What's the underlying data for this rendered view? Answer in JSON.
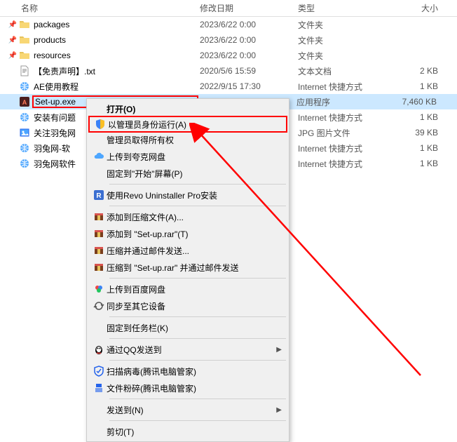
{
  "columns": {
    "name": "名称",
    "date": "修改日期",
    "type": "类型",
    "size": "大小"
  },
  "files": [
    {
      "name": "packages",
      "date": "2023/6/22 0:00",
      "type": "文件夹",
      "size": "",
      "icon": "folder",
      "pinned": true
    },
    {
      "name": "products",
      "date": "2023/6/22 0:00",
      "type": "文件夹",
      "size": "",
      "icon": "folder",
      "pinned": true
    },
    {
      "name": "resources",
      "date": "2023/6/22 0:00",
      "type": "文件夹",
      "size": "",
      "icon": "folder",
      "pinned": true
    },
    {
      "name": "【免责声明】.txt",
      "date": "2020/5/6 15:59",
      "type": "文本文档",
      "size": "2 KB",
      "icon": "txt",
      "pinned": false
    },
    {
      "name": "AE使用教程",
      "date": "2022/9/15 17:30",
      "type": "Internet 快捷方式",
      "size": "1 KB",
      "icon": "url",
      "pinned": false
    },
    {
      "name": "Set-up.exe",
      "date": "",
      "type": "应用程序",
      "size": "7,460 KB",
      "icon": "exe",
      "pinned": false,
      "selected": true,
      "highlight": true
    },
    {
      "name": "安装有问题",
      "date": "",
      "type": "Internet 快捷方式",
      "size": "1 KB",
      "icon": "url",
      "pinned": false
    },
    {
      "name": "关注羽兔网",
      "date": "",
      "type": "JPG 图片文件",
      "size": "39 KB",
      "icon": "jpg",
      "pinned": false
    },
    {
      "name": "羽兔网-软",
      "date": "",
      "type": "Internet 快捷方式",
      "size": "1 KB",
      "icon": "url",
      "pinned": false
    },
    {
      "name": "羽兔网软件",
      "date": "",
      "type": "Internet 快捷方式",
      "size": "1 KB",
      "icon": "url",
      "pinned": false
    }
  ],
  "menu": {
    "open": "打开(O)",
    "runas": "以管理员身份运行(A)",
    "takeown": "管理员取得所有权",
    "kuake": "上传到夸克网盘",
    "pintostart": "固定到\"开始\"屏幕(P)",
    "revo": "使用Revo Uninstaller Pro安装",
    "rar_add": "添加到压缩文件(A)...",
    "rar_addto": "添加到 \"Set-up.rar\"(T)",
    "rar_mail": "压缩并通过邮件发送...",
    "rar_mailto": "压缩到 \"Set-up.rar\" 并通过邮件发送",
    "baidu": "上传到百度网盘",
    "baidu_sync": "同步至其它设备",
    "pintaskbar": "固定到任务栏(K)",
    "qq": "通过QQ发送到",
    "scan": "扫描病毒(腾讯电脑管家)",
    "shred": "文件粉碎(腾讯电脑管家)",
    "sendto": "发送到(N)",
    "cut": "剪切(T)"
  }
}
